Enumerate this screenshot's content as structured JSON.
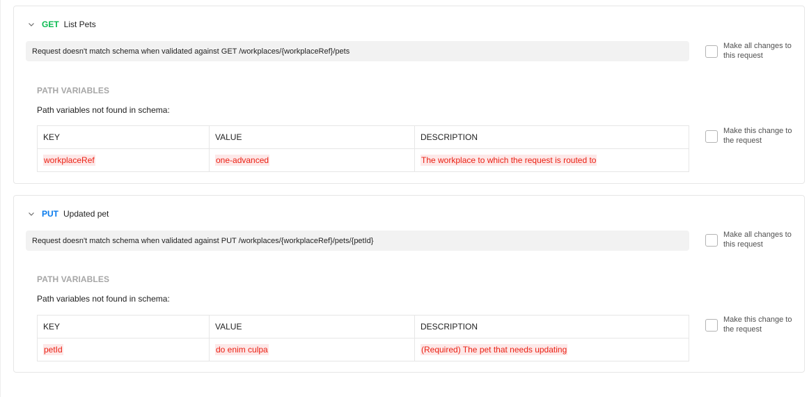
{
  "requests": [
    {
      "method": "GET",
      "name": "List Pets",
      "banner": "Request doesn't match schema when validated against GET /workplaces/{workplaceRef}/pets",
      "make_all_label": "Make all changes to this request",
      "section_title": "PATH VARIABLES",
      "section_subtitle": "Path variables not found in schema:",
      "columns": [
        "KEY",
        "VALUE",
        "DESCRIPTION"
      ],
      "rows": [
        {
          "key": "workplaceRef",
          "value": "one-advanced",
          "description": "The workplace to which the request is routed to"
        }
      ],
      "make_this_label": "Make this change to the request"
    },
    {
      "method": "PUT",
      "name": "Updated pet",
      "banner": "Request doesn't match schema when validated against PUT /workplaces/{workplaceRef}/pets/{petId}",
      "make_all_label": "Make all changes to this request",
      "section_title": "PATH VARIABLES",
      "section_subtitle": "Path variables not found in schema:",
      "columns": [
        "KEY",
        "VALUE",
        "DESCRIPTION"
      ],
      "rows": [
        {
          "key": "petId",
          "value": "do enim culpa",
          "description": "(Required) The pet that needs updating"
        }
      ],
      "make_this_label": "Make this change to the request"
    }
  ],
  "colors": {
    "get_method": "#0cbb52",
    "put_method": "#097bed",
    "modified_text": "#eb2013",
    "modified_bg": "#fde8e8"
  },
  "icons": {
    "collapse": "chevron-down-icon"
  }
}
